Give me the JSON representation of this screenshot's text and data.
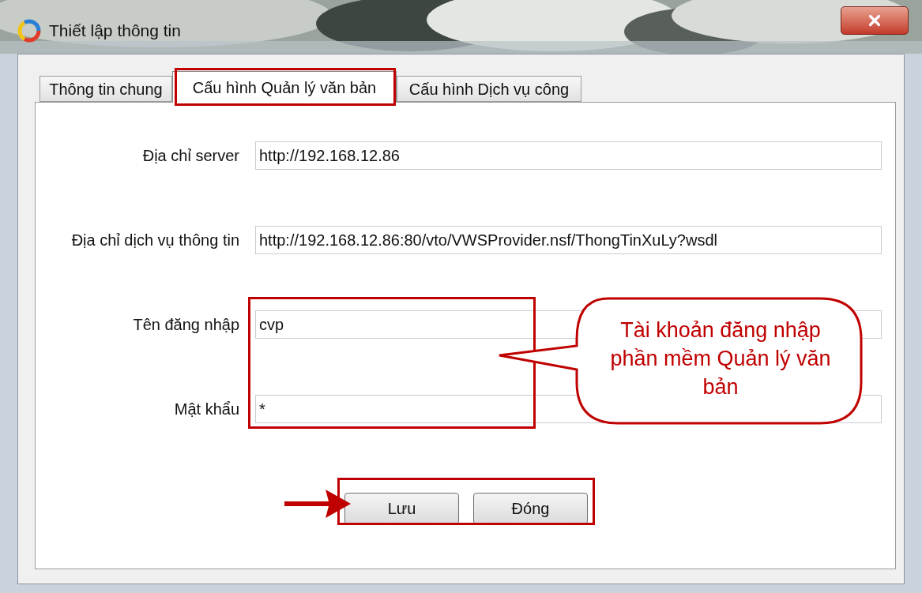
{
  "window": {
    "title": "Thiết lập thông tin"
  },
  "tabs": [
    {
      "label": "Thông tin chung",
      "selected": false
    },
    {
      "label": "Cấu hình Quản lý văn bản",
      "selected": true
    },
    {
      "label": "Cấu hình Dịch vụ công",
      "selected": false
    }
  ],
  "fields": [
    {
      "label": "Địa chỉ server",
      "value": "http://192.168.12.86"
    },
    {
      "label": "Địa chỉ dịch vụ thông tin",
      "value": "http://192.168.12.86:80/vto/VWSProvider.nsf/ThongTinXuLy?wsdl"
    },
    {
      "label": "Tên đăng nhập",
      "value": "cvp"
    },
    {
      "label": "Mật khẩu",
      "value": "*"
    }
  ],
  "buttons": [
    "Lưu",
    "Đóng"
  ],
  "callout": "Tài khoản đăng nhập phần mềm Quản lý văn bản"
}
